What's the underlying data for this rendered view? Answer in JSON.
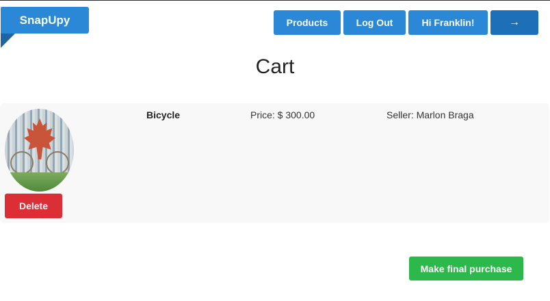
{
  "header": {
    "brand": "SnapUpy",
    "nav": {
      "products": "Products",
      "logout": "Log Out",
      "greeting": "Hi Franklin!",
      "arrow": "→"
    }
  },
  "page": {
    "title": "Cart"
  },
  "cart": {
    "items": [
      {
        "name": "Bicycle",
        "price": "Price: $ 300.00",
        "seller": "Seller: Marlon Braga",
        "delete_label": "Delete"
      }
    ]
  },
  "actions": {
    "purchase_label": "Make final purchase"
  },
  "colors": {
    "brand": "#2a88d6",
    "delete": "#dc2f35",
    "purchase": "#2db84b",
    "card_bg": "#f8f8f8"
  }
}
